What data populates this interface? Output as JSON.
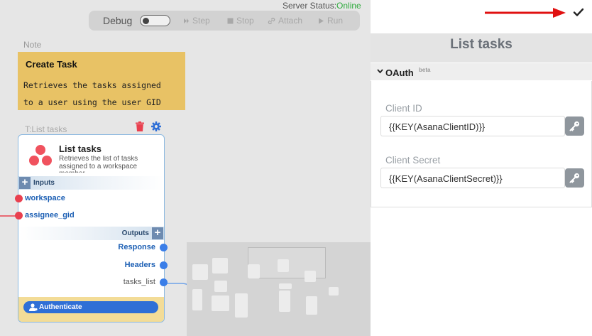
{
  "server": {
    "label": "Server Status:",
    "value": "Online"
  },
  "debug": {
    "label": "Debug",
    "buttons": [
      {
        "label": "Step",
        "icon": "step-icon"
      },
      {
        "label": "Stop",
        "icon": "stop-icon"
      },
      {
        "label": "Attach",
        "icon": "link-icon"
      },
      {
        "label": "Run",
        "icon": "play-icon"
      }
    ]
  },
  "note": {
    "label": "Note",
    "title": "Create Task",
    "body_line1": "Retrieves the tasks assigned",
    "body_line2": "to a user using the user GID"
  },
  "node": {
    "label": "T:List tasks",
    "title": "List tasks",
    "description": "Retrieves the list of tasks assigned to a workspace member",
    "inputs_label": "Inputs",
    "outputs_label": "Outputs",
    "inputs": [
      "workspace",
      "assignee_gid"
    ],
    "outputs": [
      "Response",
      "Headers",
      "tasks_list"
    ],
    "authenticate_label": "Authenticate"
  },
  "panel": {
    "title": "List tasks",
    "section_title": "OAuth",
    "section_badge": "beta",
    "client_id_label": "Client ID",
    "client_id_value": "{{KEY(AsanaClientID)}}",
    "client_secret_label": "Client Secret",
    "client_secret_value": "{{KEY(AsanaClientSecret)}}"
  },
  "colors": {
    "note_bg": "#e8c265",
    "online": "#2eaa3c",
    "port_input": "#e9404f",
    "port_output": "#3a7ee8",
    "auth_button": "#2f6fd6",
    "arrow": "#e01010"
  }
}
